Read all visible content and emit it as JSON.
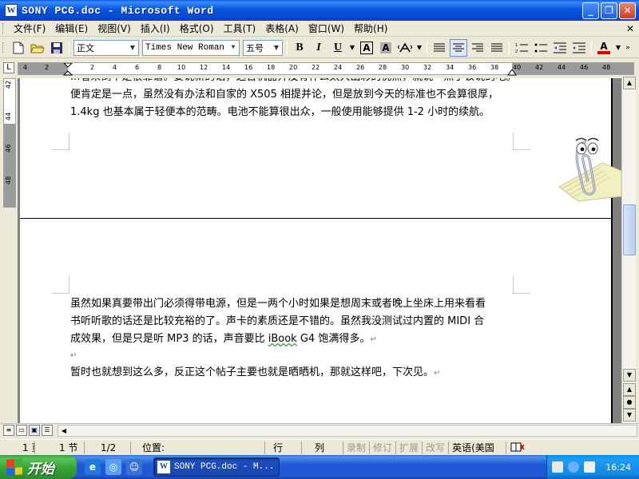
{
  "window": {
    "title": "SONY PCG.doc - Microsoft Word",
    "app_icon": "W",
    "controls": {
      "minimize": "_",
      "maximize": "❐",
      "close": "✕"
    }
  },
  "menu": {
    "items": [
      "文件(F)",
      "编辑(E)",
      "视图(V)",
      "插入(I)",
      "格式(O)",
      "工具(T)",
      "表格(A)",
      "窗口(W)",
      "帮助(H)"
    ],
    "close": "✕"
  },
  "toolbar": {
    "style": "正文",
    "font": "Times New Roman",
    "size": "五号",
    "bold": "B",
    "italic": "I",
    "underline": "U",
    "border_char": "A",
    "shade_char": "A",
    "font_color_char": "A"
  },
  "ruler": {
    "labels": [
      "4",
      "2",
      "2",
      "4",
      "6",
      "8",
      "10",
      "12",
      "14",
      "16",
      "18",
      "20",
      "22",
      "24",
      "26",
      "28",
      "30",
      "32",
      "34",
      "36",
      "38",
      "40",
      "42",
      "44",
      "46",
      "48"
    ],
    "vlabels": [
      "42",
      "44",
      "46",
      "48"
    ]
  },
  "document": {
    "page1_top_partial": "...看来倒不是很靠谱。要说新的话，这台机器开没有什么太大出彩的优点，就说一点了该说的吧。",
    "page1_line2_a": "便肯定是一点，虽然没有办法和自家的 X505 相提并论，但是放到今天的标准也不会算很厚，",
    "page1_line3": "1.4kg 也基本属于轻便本的范畴。电池不能算很出众，一般使用能够提供 1-2 小时的续航。",
    "page2_para1_l1": "虽然如果真要带出门必须得带电源，但是一两个小时如果是想周末或者晚上坐床上用来看看",
    "page2_para1_l2": "书听听歌的话还是比较充裕的了。声卡的素质还是不错的。虽然我没测试过内置的 MIDI 合",
    "page2_para1_l3a": "成效果，但是只是听 MP3 的话，声音要比 ",
    "page2_para1_l3_ibook": "iBook",
    "page2_para1_l3b": " G4 饱满得多。",
    "page2_para2": "暂时也就想到这么多，反正这个帖子主要也就是晒晒机，那就这样吧，下次见。",
    "para_mark": "↵"
  },
  "status": {
    "page": "1 页",
    "section": "1 节",
    "page_of": "1/2",
    "position": "位置:",
    "line": "行",
    "column": "列",
    "rec": "录制",
    "trk": "修订",
    "ext": "扩展",
    "ovr": "改写",
    "language": "英语(美国"
  },
  "taskbar": {
    "start": "开始",
    "task_label": "SONY PCG.doc - M...",
    "clock": "16:24"
  },
  "colors": {
    "titlebar": "#0856e0",
    "taskbar": "#2157d7",
    "start": "#38a838",
    "font_color": "#e00000"
  }
}
